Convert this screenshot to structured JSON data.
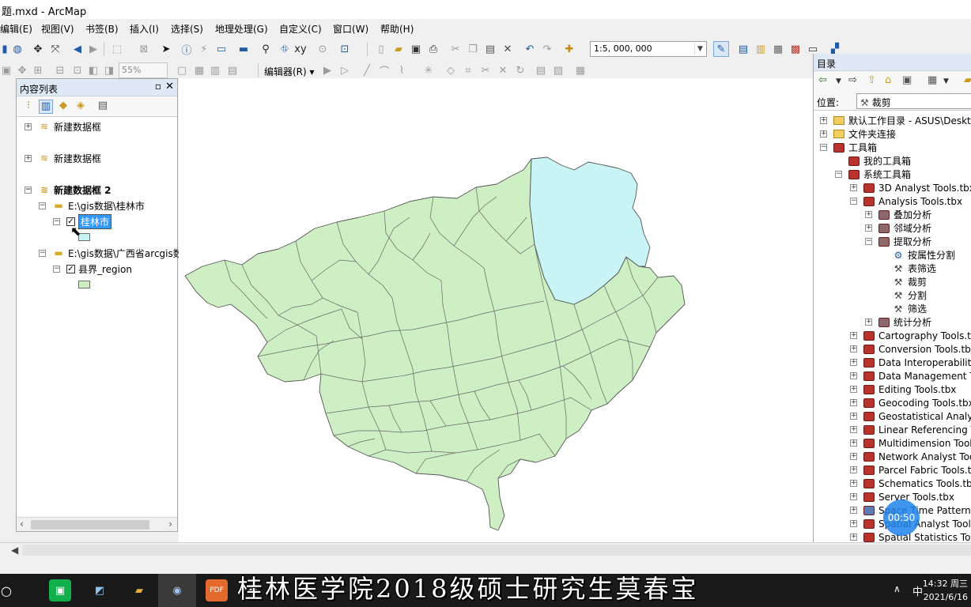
{
  "window": {
    "title": "题.mxd - ArcMap"
  },
  "menu": [
    "编辑(E)",
    "视图(V)",
    "书签(B)",
    "插入(I)",
    "选择(S)",
    "地理处理(G)",
    "自定义(C)",
    "窗口(W)",
    "帮助(H)"
  ],
  "toolbar": {
    "scale": "1:5, 000, 000",
    "zoom": "55%",
    "editor": "编辑器(R)"
  },
  "toc": {
    "title": "内容列表",
    "frames": [
      {
        "label": "新建数据框"
      },
      {
        "label": "新建数据框"
      },
      {
        "label": "新建数据框 2"
      }
    ],
    "folder1": "E:\\gis数据\\桂林市",
    "layer1": "桂林市",
    "folder2": "E:\\gis数据\\广西省arcgis数据",
    "layer2": "县界_region",
    "layer1_color": "#c9f4f5",
    "layer2_color": "#cdefc3"
  },
  "catalog": {
    "title": "目录",
    "location_label": "位置:",
    "location_value": "裁剪",
    "items": [
      "默认工作目录 - ASUS\\Desktop",
      "文件夹连接",
      "工具箱",
      "我的工具箱",
      "系统工具箱",
      "3D Analyst Tools.tbx",
      "Analysis Tools.tbx",
      "叠加分析",
      "邻域分析",
      "提取分析",
      "按属性分割",
      "表筛选",
      "裁剪",
      "分割",
      "筛选",
      "统计分析",
      "Cartography Tools.tbx",
      "Conversion Tools.tbx",
      "Data Interoperability Tools.tbx",
      "Data Management Tools.tbx",
      "Editing Tools.tbx",
      "Geocoding Tools.tbx",
      "Geostatistical Analyst Tools.tbx",
      "Linear Referencing Tools.tbx",
      "Multidimension Tools.tbx",
      "Network Analyst Tools.tbx",
      "Parcel Fabric Tools.tbx",
      "Schematics Tools.tbx",
      "Server Tools.tbx",
      "Space Time Pattern Mining Tools.tbx",
      "Spatial Analyst Tools.tbx",
      "Spatial Statistics Tools.tbx"
    ]
  },
  "overlay": {
    "timer": "00:50",
    "caption": "桂林医学院2018级硕士研究生莫春宝"
  },
  "taskbar": {
    "time": "14:32 周三",
    "date": "2021/6/16",
    "ime": "中"
  }
}
